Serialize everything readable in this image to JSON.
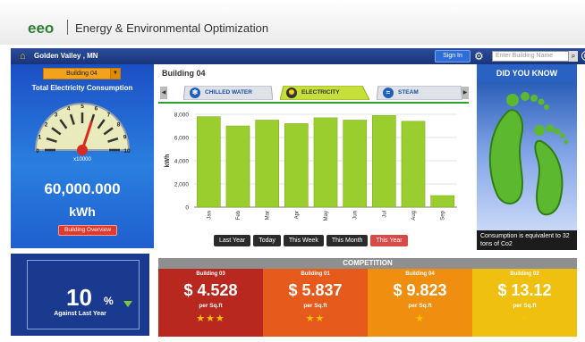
{
  "brand": {
    "logo_text": "eeo",
    "name": "Energy & Environmental Optimization"
  },
  "navbar": {
    "location": "Golden Valley , MN",
    "signin_label": "Sign In",
    "search_placeholder": "Enter Building Name",
    "colors": {
      "bar": "#1f3f8f",
      "signin": "#2e6ed6"
    }
  },
  "left_panel": {
    "building_select": "Building 04",
    "title": "Total Electricity Consumption",
    "gauge_ticks": [
      "0",
      "1",
      "2",
      "3",
      "4",
      "5",
      "6",
      "7",
      "8",
      "9",
      "10"
    ],
    "gauge_multiplier": "x10000",
    "gauge_level": 0.6,
    "value": "60,000.000",
    "unit": "kWh",
    "overview_button": "Building Overview"
  },
  "change_panel": {
    "value": "10",
    "symbol": "%",
    "direction": "down",
    "label": "Against Last Year"
  },
  "main": {
    "title": "Building 04",
    "tabs": [
      {
        "label": "CHILLED WATER",
        "icon": "snowflake-icon",
        "active": false
      },
      {
        "label": "ELECTRICITY",
        "icon": "bulb-icon",
        "active": true
      },
      {
        "label": "STEAM",
        "icon": "steam-icon",
        "active": false
      }
    ],
    "periods": [
      {
        "label": "Last Year",
        "active": false
      },
      {
        "label": "Today",
        "active": false
      },
      {
        "label": "This Week",
        "active": false
      },
      {
        "label": "This Month",
        "active": false
      },
      {
        "label": "This Year",
        "active": true
      }
    ]
  },
  "chart_data": {
    "type": "bar",
    "categories": [
      "Jan",
      "Feb",
      "Mar",
      "Apr",
      "May",
      "Jun",
      "Jul",
      "Aug",
      "Sep"
    ],
    "values": [
      7800,
      7000,
      7500,
      7200,
      7700,
      7500,
      7900,
      7400,
      1000
    ],
    "ylabel": "kWh",
    "yticks": [
      "0",
      "2,000",
      "4,000",
      "6,000",
      "8,000"
    ],
    "ylim": [
      0,
      8000
    ],
    "grid": true,
    "bar_color": "#9acd2e"
  },
  "did_you_know": {
    "title": "DID YOU KNOW",
    "caption": "Consumption is equivalent to 32 tons of Co2"
  },
  "competition": {
    "title": "COMPETITION",
    "cards": [
      {
        "name": "Building 03",
        "value": "$ 4.528",
        "unit": "per Sq.ft",
        "stars": "★★★",
        "color": "#b8281f"
      },
      {
        "name": "Building 01",
        "value": "$ 5.837",
        "unit": "per Sq.ft",
        "stars": "★★",
        "color": "#e65a1c"
      },
      {
        "name": "Building 04",
        "value": "$ 9.823",
        "unit": "per Sq.ft",
        "stars": "★",
        "color": "#f08e10"
      },
      {
        "name": "Building 02",
        "value": "$ 13.12",
        "unit": "per Sq.ft",
        "stars": "★",
        "color": "#f0c010"
      }
    ]
  }
}
